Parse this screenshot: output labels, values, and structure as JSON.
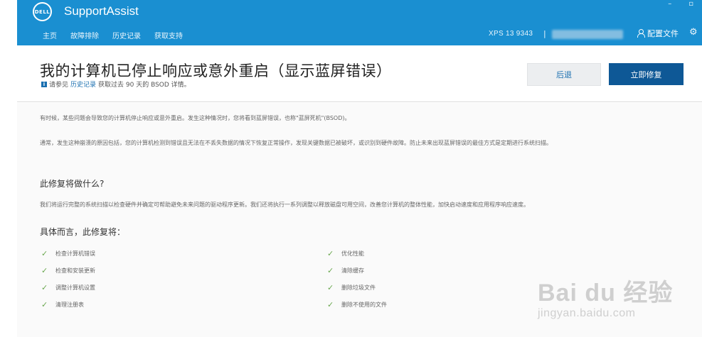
{
  "app": {
    "title": "SupportAssist",
    "logo_text": "DELL",
    "window_controls": [
      "–",
      "▫"
    ]
  },
  "nav": {
    "items": [
      "主页",
      "故障排除",
      "历史记录",
      "获取支持"
    ]
  },
  "device": {
    "model": "XPS 13 9343",
    "separator": "|"
  },
  "profile": {
    "label": "配置文件"
  },
  "page": {
    "title": "我的计算机已停止响应或意外重启（显示蓝屏错误）",
    "subnote_prefix": "请参见",
    "subnote_link": "历史记录",
    "subnote_suffix": "获取过去 90 天的 BSOD 详情。"
  },
  "buttons": {
    "back": "后退",
    "fix": "立即修复"
  },
  "content": {
    "p1": "有时候，某些问题会导致您的计算机停止响应或意外重启。发生这种情况时，您将看到蓝屏错误，也称\"蓝屏死机\"(BSOD)。",
    "p2": "通常，发生这种崩溃的原因包括，您的计算机检测到错误且无法在不丢失数据的情况下恢复正常操作，发现关键数据已被破坏，或识别到硬件故障。防止未来出现蓝屏错误的最佳方式是定期进行系统扫描。",
    "h_what": "此修复将做什么?",
    "p3": "我们将运行完整的系统扫描以检查硬件并确定可帮助避免未来问题的驱动程序更新。我们还将执行一系列调整以释放磁盘可用空间，改善您计算机的整体性能，加快启动速度和应用程序响应速度。",
    "h_specific": "具体而言，此修复将：",
    "left_items": [
      "检查计算机错误",
      "检查和安装更新",
      "调整计算机设置",
      "清理注册表"
    ],
    "right_items": [
      "优化性能",
      "清除缓存",
      "删除垃圾文件",
      "删除不使用的文件"
    ]
  },
  "watermark": {
    "main": "Bai du 经验",
    "sub": "jingyan.baidu.com"
  },
  "colors": {
    "header": "#1a8fd1",
    "primary_button": "#0e5896",
    "check": "#6aa84f"
  }
}
